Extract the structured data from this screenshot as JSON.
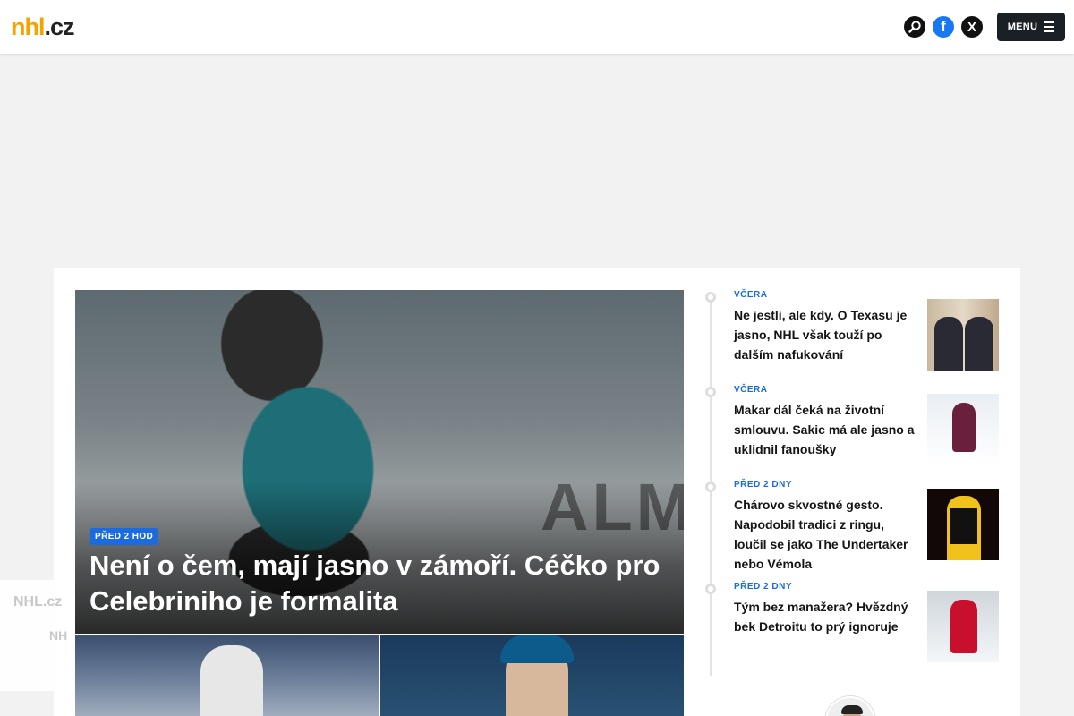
{
  "header": {
    "logo_part1": "nhl",
    "logo_part2": ".cz",
    "facebook_glyph": "f",
    "x_glyph": "X",
    "menu_label": "MENU",
    "icons": [
      "search-icon",
      "facebook-icon",
      "x-icon",
      "hamburger-icon"
    ]
  },
  "hero": {
    "time_tag": "PŘED 2 HOD",
    "title": "Není o čem, mají jasno v zámoří. Céčko pro Celebriniho je formalita",
    "backdrop_text": "ALMA"
  },
  "news": [
    {
      "time": "VČERA",
      "title": "Ne jestli, ale kdy. O Texasu je jasno, NHL však touží po dalším nafukování"
    },
    {
      "time": "VČERA",
      "title": "Makar dál čeká na životní smlouvu. Sakic má ale jasno a uklidnil fanoušky"
    },
    {
      "time": "PŘED 2 DNY",
      "title": "Chárovo skvostné gesto. Napodobil tradici z ringu, loučil se jako The Undertaker nebo Vémola"
    },
    {
      "time": "PŘED 2 DNY",
      "title": "Tým bez manažera? Hvězdný bek Detroitu to prý ignoruje"
    }
  ],
  "banner": {
    "line1": "NHL.cz",
    "line2": "NH"
  },
  "colors": {
    "accent": "#1a6be0",
    "logo_orange": "#f5a300",
    "menu_bg": "#1b1f26",
    "facebook": "#1877f2"
  }
}
